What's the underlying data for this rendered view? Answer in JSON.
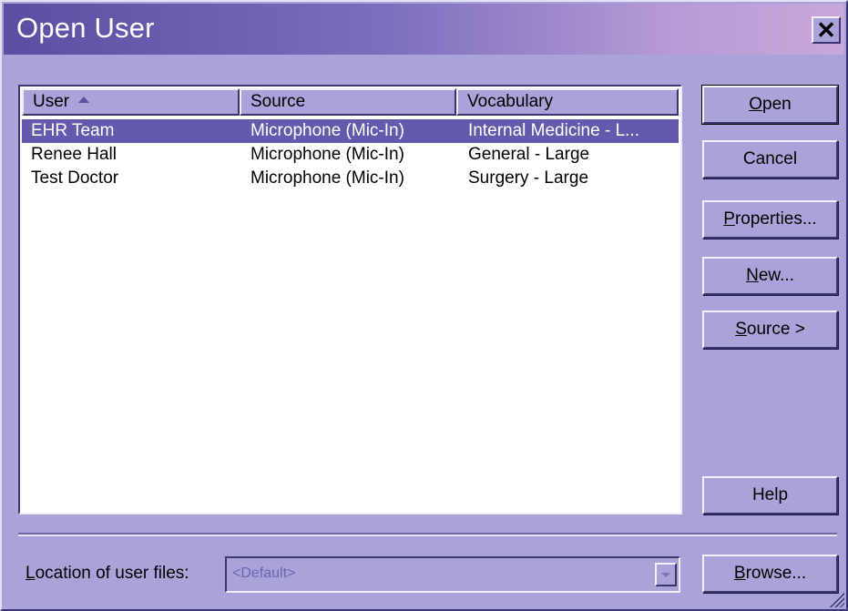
{
  "window": {
    "title": "Open User",
    "close_symbol": "✕"
  },
  "listview": {
    "columns": [
      "User",
      "Source",
      "Vocabulary"
    ],
    "rows": [
      {
        "user": "EHR Team",
        "source": "Microphone (Mic-In)",
        "vocabulary": "Internal Medicine - L...",
        "selected": true
      },
      {
        "user": "Renee Hall",
        "source": "Microphone (Mic-In)",
        "vocabulary": "General - Large",
        "selected": false
      },
      {
        "user": "Test Doctor",
        "source": "Microphone (Mic-In)",
        "vocabulary": "Surgery - Large",
        "selected": false
      }
    ],
    "sort_column": "User",
    "sort_direction": "ascending"
  },
  "buttons": {
    "open": {
      "mnemonic": "O",
      "rest": "pen"
    },
    "cancel": "Cancel",
    "properties": {
      "mnemonic": "P",
      "rest": "roperties..."
    },
    "new": {
      "mnemonic": "N",
      "rest": "ew..."
    },
    "source": {
      "mnemonic": "S",
      "rest": "ource >"
    },
    "help": "Help",
    "browse": {
      "mnemonic": "B",
      "rest": "rowse..."
    }
  },
  "location": {
    "label_mnemonic": "L",
    "label_rest": "ocation of user files:",
    "value": "<Default>"
  },
  "colors": {
    "dialog_bg": "#a9a3d9",
    "selection": "#6359ad",
    "titlebar_start": "#5b4da1",
    "titlebar_end": "#c8a7dc"
  }
}
